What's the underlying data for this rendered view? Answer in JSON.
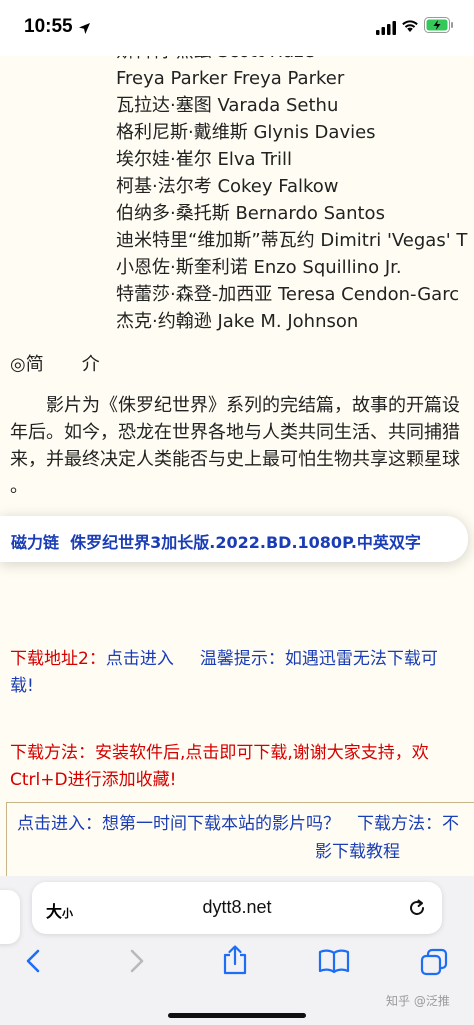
{
  "status_bar": {
    "time": "10:55",
    "battery_charging": true
  },
  "cast": [
    "斯科特·黑兹 Scott Haze",
    "Freya Parker Freya Parker",
    "瓦拉达·塞图 Varada Sethu",
    "格利尼斯·戴维斯 Glynis Davies",
    "埃尔娃·崔尔 Elva Trill",
    "柯基·法尔考 Cokey Falkow",
    "伯纳多·桑托斯 Bernardo Santos",
    "迪米特里“维加斯”蒂瓦约 Dimitri 'Vegas' T",
    "小恩佐·斯奎利诺 Enzo Squillino Jr.",
    "特蕾莎·森登-加西亚 Teresa Cendon-Garc",
    "杰克·约翰逊 Jake M. Johnson"
  ],
  "intro": {
    "symbol": "◎",
    "heading_a": "简",
    "heading_b": "介",
    "lines": [
      "　　影片为《侏罗纪世界》系列的完结篇，故事的开篇设",
      "年后。如今，恐龙在世界各地与人类共同生活、共同捕猎",
      "来，并最终决定人类能否与史上最可怕生物共享这颗星球",
      "。"
    ]
  },
  "magnet": {
    "label": "磁力链",
    "title": "侏罗纪世界3加长版.2022.BD.1080P.中英双字"
  },
  "download": {
    "address_label": "下载地址2：",
    "enter_link": "点击进入",
    "tip_label": "温馨提示：",
    "tip_text": "如遇迅雷无法下载可",
    "tip_cont": "载!",
    "method_line1": "下载方法：安装软件后,点击即可下载,谢谢大家支持，欢",
    "method_line2": "Ctrl+D进行添加收藏!"
  },
  "notice": {
    "line1": "点击进入：想第一时间下载本站的影片吗？　下载方法：不",
    "line2": "影下载教程"
  },
  "browser": {
    "text_size_big": "大",
    "text_size_small": "小",
    "url": "dytt8.net"
  },
  "watermark": "知乎 @泛推"
}
